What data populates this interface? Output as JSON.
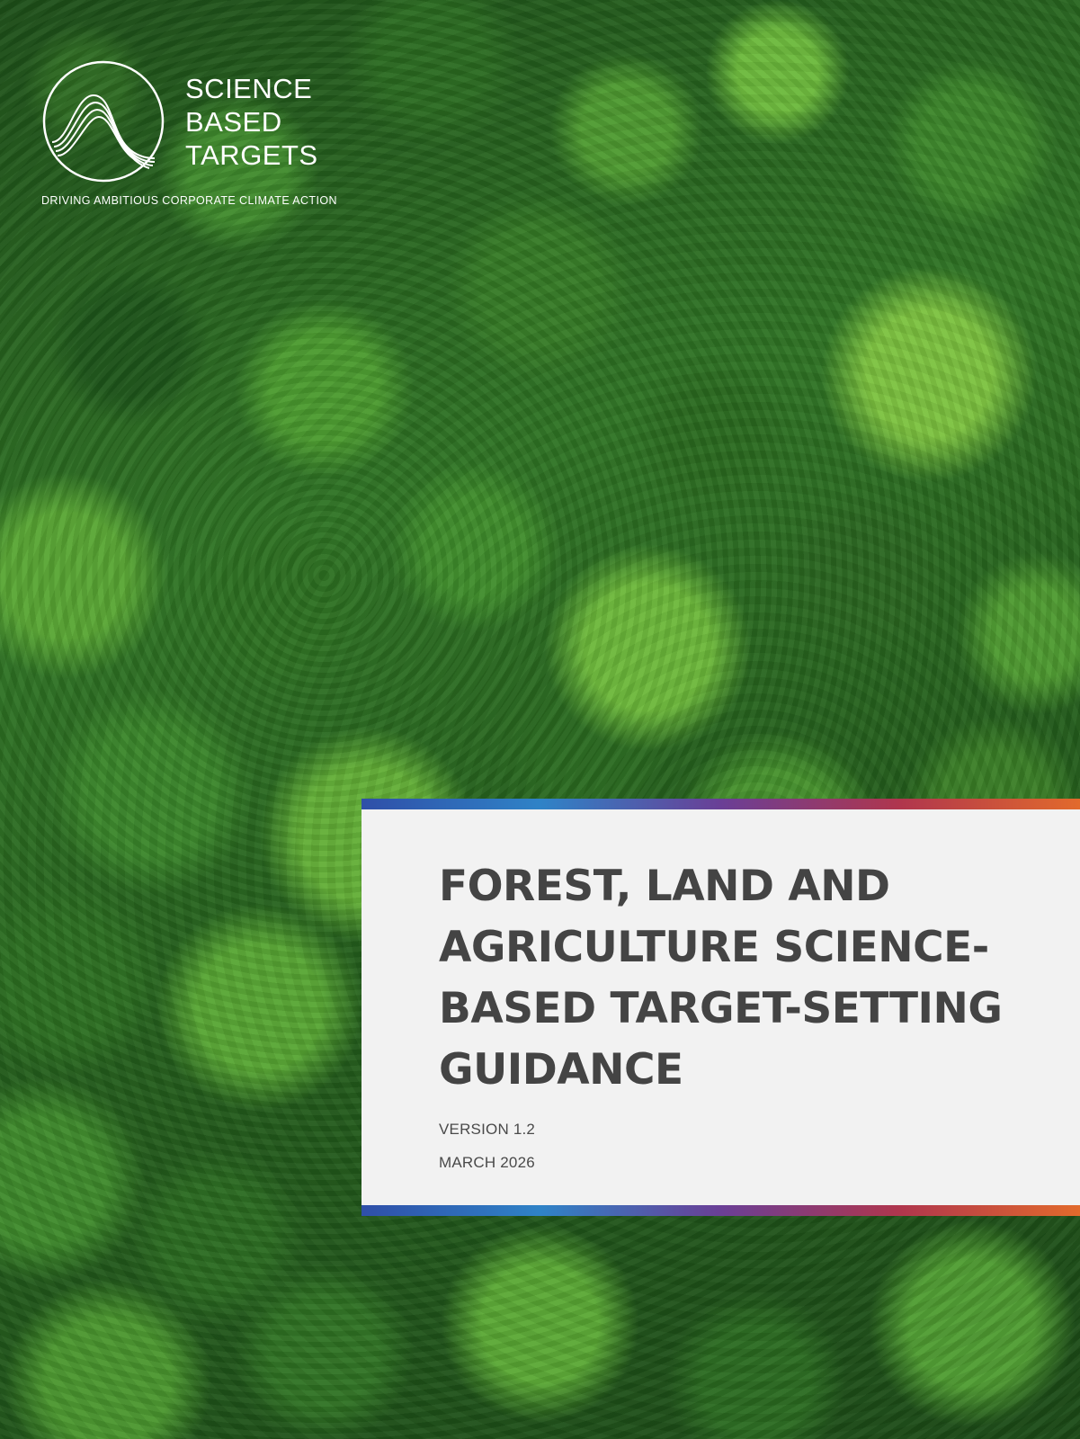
{
  "logo": {
    "words": [
      "SCIENCE",
      "BASED",
      "TARGETS"
    ],
    "tagline": "DRIVING AMBITIOUS CORPORATE CLIMATE ACTION"
  },
  "title": {
    "lines": [
      "FOREST, LAND AND",
      "AGRICULTURE SCIENCE-",
      "BASED TARGET-SETTING",
      "GUIDANCE"
    ]
  },
  "version": "VERSION 1.2",
  "date": "MARCH 2026",
  "colors": {
    "title_text": "#444444",
    "card_background": "#f2f2f2",
    "accent_gradient": [
      "#2f4fa8",
      "#2f83c7",
      "#6a3f96",
      "#b0364d",
      "#e26a2c"
    ]
  },
  "icons": {
    "logo_mark": "circle-wave-icon"
  }
}
